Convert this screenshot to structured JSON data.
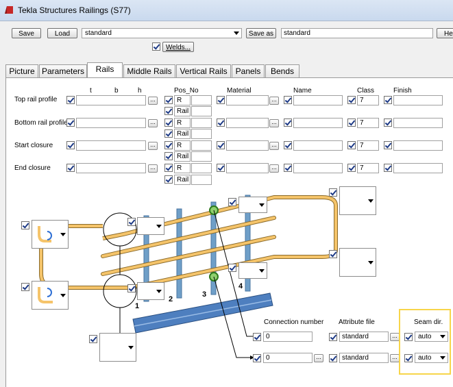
{
  "window": {
    "title": "Tekla Structures  Railings (S77)"
  },
  "toolbar": {
    "save_label": "Save",
    "load_label": "Load",
    "preset_value": "standard",
    "save_as_label": "Save as",
    "save_as_value": "standard",
    "help_label": "He"
  },
  "welds": {
    "label": "Welds..."
  },
  "tabs": [
    "Picture",
    "Parameters",
    "Rails",
    "Middle Rails",
    "Vertical Rails",
    "Panels",
    "Bends"
  ],
  "columns": {
    "t": "t",
    "b": "b",
    "h": "h",
    "pos_no": "Pos_No",
    "material": "Material",
    "name": "Name",
    "class": "Class",
    "finish": "Finish"
  },
  "rows": [
    {
      "label": "Top rail profile",
      "pos_prefix": "R",
      "pos_sub": "Rail",
      "class": "7"
    },
    {
      "label": "Bottom rail profile",
      "pos_prefix": "R",
      "pos_sub": "Rail",
      "class": "7"
    },
    {
      "label": "Start closure",
      "pos_prefix": "R",
      "pos_sub": "Rail",
      "class": "7"
    },
    {
      "label": "End closure",
      "pos_prefix": "R",
      "pos_sub": "Rail",
      "class": "7"
    }
  ],
  "diagram": {
    "post_labels": [
      "1",
      "2",
      "3",
      "4"
    ]
  },
  "connection": {
    "number_label": "Connection number",
    "attribute_label": "Attribute file",
    "seam_label": "Seam dir.",
    "rows": [
      {
        "number": "0",
        "attribute": "standard",
        "seam": "auto"
      },
      {
        "number": "0",
        "attribute": "standard",
        "seam": "auto"
      }
    ]
  },
  "colors": {
    "rail": "#f5c46a",
    "post": "#6f9fc8",
    "highlight": "#f7d54a"
  }
}
